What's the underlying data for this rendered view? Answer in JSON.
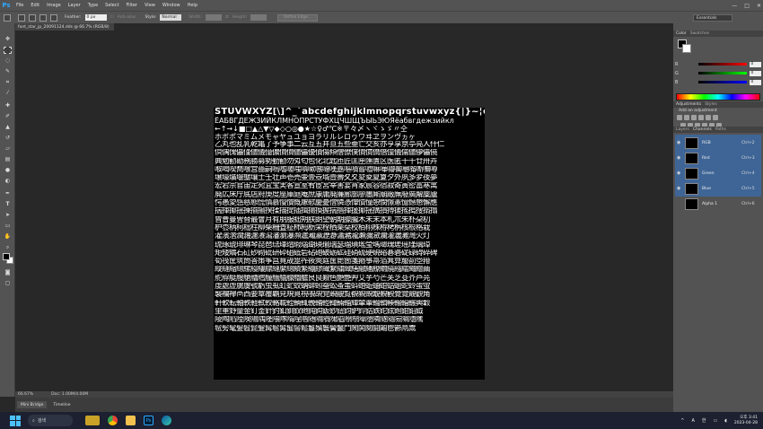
{
  "menubar": {
    "logo": "Ps",
    "items": [
      "File",
      "Edit",
      "Image",
      "Layer",
      "Type",
      "Select",
      "Filter",
      "View",
      "Window",
      "Help"
    ],
    "window_controls": [
      "—",
      "□",
      "✕"
    ]
  },
  "options": {
    "feather_label": "Feather:",
    "feather_value": "0 px",
    "antialias_label": "Anti-alias",
    "style_label": "Style:",
    "style_value": "Normal",
    "width_label": "Width:",
    "height_label": "Height:",
    "refine_edge": "Refine Edge...",
    "workspace": "Essentials"
  },
  "document": {
    "tab_title": "font_star_jp_20091124.dds @ 66.7% (RGB/8)",
    "zoom": "66.67%",
    "doc_info": "Doc: 1.00M/4.00M"
  },
  "glyphs": {
    "line1": "STUVWXYZ[\\]^_`abcdefghijklmnopqrstuvwxyz{|}~¦¢£¥¦§",
    "line2": "ЁАБВГДЕЖЗИЙКЛМНОПРСТУФХЦЧШЩЪЫЬЭЮЯёабвгдежзийкл",
    "line3": "←↑→↓■□▲△▼▽◆◇○◎●★☆♀♂℃※〒々〆ヽヾゝゞ〃仝",
    "line4": "ホボポマミムメモャヤュユョヨラリルレロヮワヰヱヲンヴヵヶ",
    "cjk": [
      "乙丸也乱乳乾亀了予争事二云互五井亘五些亜亡交亥亦亨享京亭亮人什仁",
      "倶偶傀儡僅儘儀億儂價價儘儡優債傷傾僧僚僕價償僑僭僮儀儒儘儚儡僥",
      "典勉勧勘務勝募勢勤勧勿匁匂包化北匙匝匠匡匣匯匱区医匿十千廿卅卉",
      "喉喝喫喬喰営嗇嗣嗚嗜嗟嗤嗔嗽嗾嗹嘆嘉嘔嘖嘗嘘嘛嘩嘯嘱嘲嘴嘶嘸噂",
      "壌壕壙壜壟壤士壬壮声壱売壷壹壺壻壼壽夂夊夋夌夏夐夕外夙多夛夜夢",
      "宏宕宗官宙定宛宜宝実客宣室宥宦宮宰害宴宵家宸容宿寂寄寅密富寒寓",
      "廃広床庁底店府庚度座庫庭庵庶康庸廃廉廊廓廖廛廝廟廠廡廢廣廨廩廬",
      "愕愚愛感慈態慌慎慕慢慣慨慮慰慶憂憎憐憑憚憤憧憩憫憬憲憶憾懇懈應",
      "揣揮揶揺揀揃揄揆揉描提插揖揚換握揣揩揮援揶揺搆損搏搓搖搗搜搦搨",
      "曾曹曼曽替最會月有朋服朏朔朕朗望朝期朦朧木未末本札朮朱朴朶朷",
      "枦枩柄柯柮柱柳柴柵査柾柿栂栃栄栓栖栗栞校栢栩株栫栲栴核根格栽",
      "濯濱濳濶濺濾瀁瀉瀋瀏瀑瀕瀘瀚瀛瀝瀞瀟瀦瀧瀬瀰瀲瀾灌灑灘灣火灯",
      "琉琢琥琲琳琴琵琶琺琿瑁瑕瑙瑚瑛瑜瑞瑟瑠瑣瑤瑩瑪瑯瑰瑳瑶瑾璃璋",
      "矩矮矯石矼砂砌砒研砕砠砥砦砧砲破砺砿硅硝硫硬硯硲碁碆碇碌碍碎碑",
      "筍筏筐筑筒答策筝筥筧筬筮筰筱筴筵筺箆箇箋箍箏箒箔箕算箙箚箜箝",
      "縦縫縮總縲縵縷縹縺縻總績繁繃繆繊繋繍織繕繖繙繚繝繞繦繧繩繪繭",
      "舵艀艇艘艙艚艝艟艢艤艨艪艫艮良艱色艶艷艸艾芋芍芒芙芝芟芥芦芫",
      "虔處虚虜虞號虧虫虱虹虻蚊蚋蚌蚓蚕蚣蚤蚩蚪蚫蚯蚰蚶蛄蛆蛇蛉蛋蛍",
      "襲襴襷襾西要覃覆覇見規覓視覗覘覚覡覦覧覩親覬覯覲観覺覽覿觀角",
      "軒軟転軸軼軽軾較輅載輊輌輒輓輔輕輙輛輜輝輦輩輪輯輳輸輻輾輿轂",
      "里重野量金釘釜針釣釦釧釵釶鈍鈎鈑鈔鈕鈞鈩鈴鈷鉄鉈鉉鉋鉗鉛鉞",
      "陵陶陷陸険陽隅隆隈隊隋隍階随隔隕隗隘隙際障隠隣隧隨險隰隱隲",
      "髢髣髦髪髫髭髮髯髱髴髷髻鬆鬘鬚鬟鬢鬣鬥鬧鬨鬩鬪鬮鬯鬱鬲鬻"
    ]
  },
  "right_panel": {
    "color_tabs": [
      "Color",
      "Swatches"
    ],
    "sliders": [
      {
        "label": "R",
        "value": "0",
        "gradient": "linear-gradient(to right,#000,#f00)"
      },
      {
        "label": "G",
        "value": "0",
        "gradient": "linear-gradient(to right,#000,#0f0)"
      },
      {
        "label": "B",
        "value": "0",
        "gradient": "linear-gradient(to right,#000,#00f)"
      }
    ],
    "adj_tabs": [
      "Adjustments",
      "Styles"
    ],
    "add_adjustment": "Add an adjustment",
    "channel_tabs": [
      "Layers",
      "Channels",
      "Paths"
    ],
    "channels": [
      {
        "name": "RGB",
        "shortcut": "Ctrl+2"
      },
      {
        "name": "Red",
        "shortcut": "Ctrl+3"
      },
      {
        "name": "Green",
        "shortcut": "Ctrl+4"
      },
      {
        "name": "Blue",
        "shortcut": "Ctrl+5"
      },
      {
        "name": "Alpha 1",
        "shortcut": "Ctrl+6"
      }
    ]
  },
  "bottom_tabs": [
    "Mini Bridge",
    "Timeline"
  ],
  "taskbar": {
    "search_placeholder": "검색",
    "tray_lang": "A",
    "tray_ime": "한",
    "time": "오후 3:41",
    "date": "2023-04-28"
  },
  "colors": {
    "accent_ps": "#31a8ff",
    "panel_bg": "#535353",
    "canvas_bg": "#000000"
  }
}
